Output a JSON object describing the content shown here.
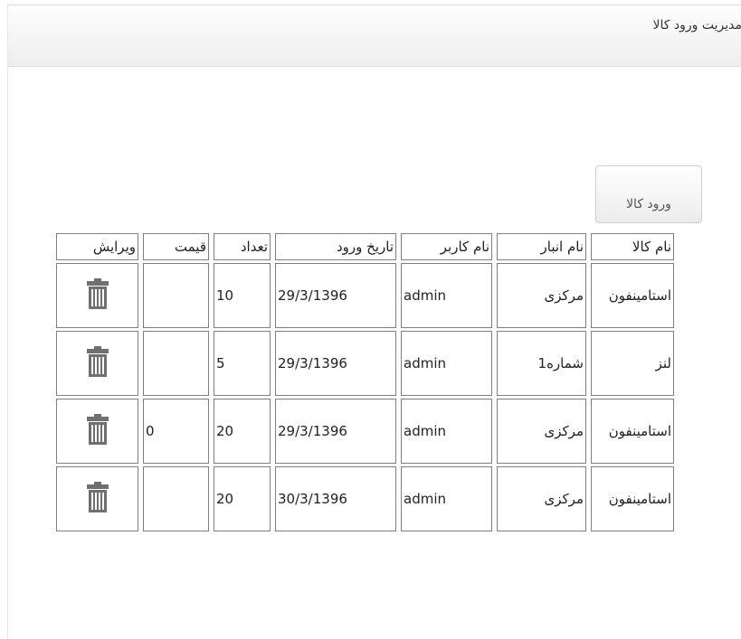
{
  "panel": {
    "title": "مدیریت ورود کالا"
  },
  "toolbar": {
    "add_label": "ورود کالا"
  },
  "table": {
    "headers": [
      "نام کالا",
      "نام انبار",
      "نام کاربر",
      "تاریخ ورود",
      "تعداد",
      "قیمت",
      "ویرایش"
    ],
    "rows": [
      {
        "product": "استامینفون",
        "warehouse": "مرکزی",
        "user": "admin",
        "date": "29/3/1396",
        "quantity": "10",
        "price": "",
        "action_icon": "trash-icon"
      },
      {
        "product": "لنز",
        "warehouse": "شماره1",
        "user": "admin",
        "date": "29/3/1396",
        "quantity": "5",
        "price": "",
        "action_icon": "trash-icon"
      },
      {
        "product": "استامینفون",
        "warehouse": "مرکزی",
        "user": "admin",
        "date": "29/3/1396",
        "quantity": "20",
        "price": "0",
        "action_icon": "trash-icon"
      },
      {
        "product": "استامینفون",
        "warehouse": "مرکزی",
        "user": "admin",
        "date": "30/3/1396",
        "quantity": "20",
        "price": "",
        "action_icon": "trash-icon"
      }
    ]
  },
  "colors": {
    "border": "#7f7f7f",
    "icon": "#6f6f6f",
    "header_bg": "#eeeeee"
  }
}
